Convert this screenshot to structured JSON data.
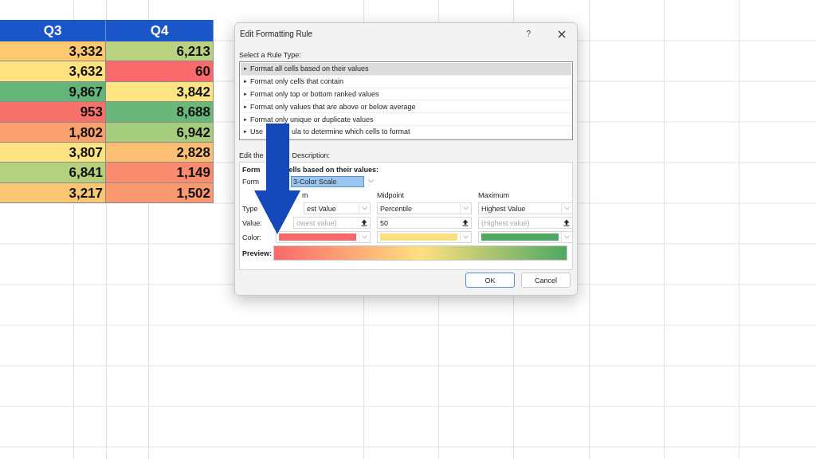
{
  "sheet": {
    "columns": [
      {
        "header": "Q3",
        "cells": [
          {
            "value": "3,332",
            "color": "#fcc870"
          },
          {
            "value": "3,632",
            "color": "#fee27f"
          },
          {
            "value": "9,867",
            "color": "#63b57a"
          },
          {
            "value": "953",
            "color": "#f8726b"
          },
          {
            "value": "1,802",
            "color": "#fba06f"
          },
          {
            "value": "3,807",
            "color": "#fee481"
          },
          {
            "value": "6,841",
            "color": "#b5d07e"
          },
          {
            "value": "3,217",
            "color": "#fcc775"
          }
        ]
      },
      {
        "header": "Q4",
        "cells": [
          {
            "value": "6,213",
            "color": "#bad180"
          },
          {
            "value": "60",
            "color": "#f8696b"
          },
          {
            "value": "3,842",
            "color": "#fee582"
          },
          {
            "value": "8,688",
            "color": "#6ab77a"
          },
          {
            "value": "6,942",
            "color": "#a6cc7e"
          },
          {
            "value": "2,828",
            "color": "#fdbf73"
          },
          {
            "value": "1,149",
            "color": "#f98b6f"
          },
          {
            "value": "1,502",
            "color": "#fa9870"
          }
        ]
      }
    ]
  },
  "dialog": {
    "title": "Edit Formatting Rule",
    "help": "?",
    "rule_type_label": "Select a Rule Type:",
    "rule_types": [
      {
        "marker": "►",
        "parts": [
          "Format all cells based on their values"
        ],
        "selected": true
      },
      {
        "marker": "►",
        "parts": [
          "Format only cells that contain"
        ],
        "selected": false
      },
      {
        "marker": "►",
        "parts": [
          "Format only top or bottom ranked values"
        ],
        "selected": false
      },
      {
        "marker": "►",
        "parts": [
          "Format only values that are above or below average"
        ],
        "selected": false
      },
      {
        "marker": "►",
        "parts": [
          "Format only unique or duplicate values"
        ],
        "selected": false
      },
      {
        "marker": "►",
        "parts": [
          "Use",
          "ula to determine which cells to format"
        ],
        "selected": false
      }
    ],
    "description_label": [
      "Edit the",
      "Description:"
    ],
    "heading": [
      "Form",
      "ells based on their values:"
    ],
    "format_style": {
      "label": "Form",
      "value": "3-Color Scale"
    },
    "row_labels": [
      "Type",
      "Value:",
      "Color:"
    ],
    "points": [
      {
        "name": "m",
        "type": "est Value",
        "placeholder": "owest value)",
        "color": "#f8696b"
      },
      {
        "name": "Midpoint",
        "type": "Percentile",
        "value": "50",
        "color": "#ffe07f"
      },
      {
        "name": "Maximum",
        "type": "Highest Value",
        "placeholder": "(Highest value)",
        "color": "#4ea864"
      }
    ],
    "preview_label": "Preview:",
    "buttons": [
      {
        "label": "OK",
        "default": true
      },
      {
        "label": "Cancel",
        "default": false
      }
    ]
  }
}
